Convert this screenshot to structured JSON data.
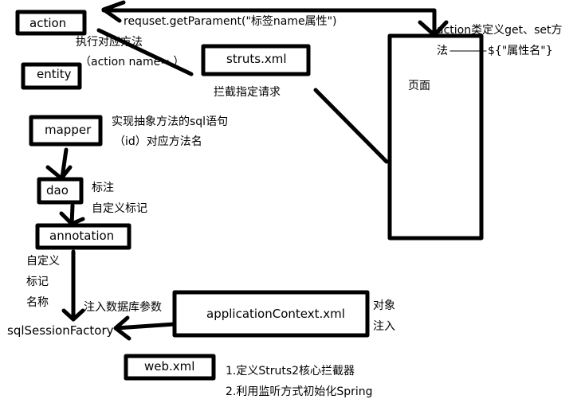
{
  "boxes": {
    "action": "action",
    "entity": "entity",
    "struts": "struts.xml",
    "page": "页面",
    "mapper": "mapper",
    "dao": "dao",
    "annotation": "annotation",
    "sql_session_factory": "sqlSessionFactory",
    "application_context": "applicationContext.xml",
    "web_xml": "web.xml"
  },
  "labels": {
    "get_parameter": "requset.getParament(\"标签name属性\")",
    "execute_method": "执行对应方法",
    "action_name": "（action name= ）",
    "intercept": "拦截指定请求",
    "getset_line1": "action类定义get、set方",
    "getset_line2": "法",
    "el_expr": "${\"属性名\"}",
    "mapper_desc1": "实现抽象方法的sql语句",
    "mapper_desc2": "（id）对应方法名",
    "dao_desc1": "标注",
    "dao_desc2": "自定义标记",
    "annot_desc1": "自定义",
    "annot_desc2": "标记",
    "annot_desc3": "名称",
    "inject_db": "注入数据库参数",
    "obj_inject1": "对象",
    "obj_inject2": "注入",
    "web_desc1": "1.定义Struts2核心拦截器",
    "web_desc2": "2.利用监听方式初始化Spring"
  },
  "colors": {
    "stroke": "#000000",
    "background": "#ffffff"
  }
}
